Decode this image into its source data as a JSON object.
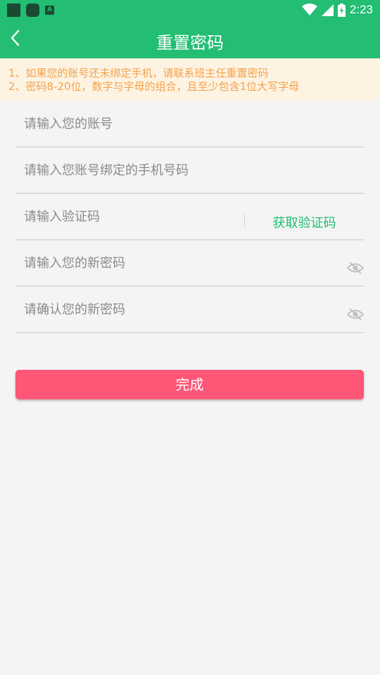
{
  "colors": {
    "primary": "#23bd73",
    "notice_bg": "#fdf3e3",
    "notice_text": "#f4a24a",
    "submit": "#fe5676",
    "page_bg": "#f4f4f4"
  },
  "status_bar": {
    "time": "2:23",
    "icons": [
      "notification-square-icon",
      "notification-rounded-icon",
      "keyboard-a-icon",
      "wifi-icon",
      "signal-icon",
      "battery-charging-icon"
    ],
    "app_icon_letter": "A"
  },
  "header": {
    "title": "重置密码",
    "back_icon": "chevron-left-icon"
  },
  "notice": {
    "lines": [
      "1、如果您的账号还未绑定手机，请联系班主任重置密码",
      "2、密码8-20位，数字与字母的组合，且至少包含1位大写字母"
    ]
  },
  "form": {
    "account_placeholder": "请输入您的账号",
    "phone_placeholder": "请输入您账号绑定的手机号码",
    "code_placeholder": "请输入验证码",
    "get_code_label": "获取验证码",
    "new_password_placeholder": "请输入您的新密码",
    "confirm_password_placeholder": "请确认您的新密码",
    "eye_icon": "eye-hidden-icon"
  },
  "submit": {
    "label": "完成"
  }
}
